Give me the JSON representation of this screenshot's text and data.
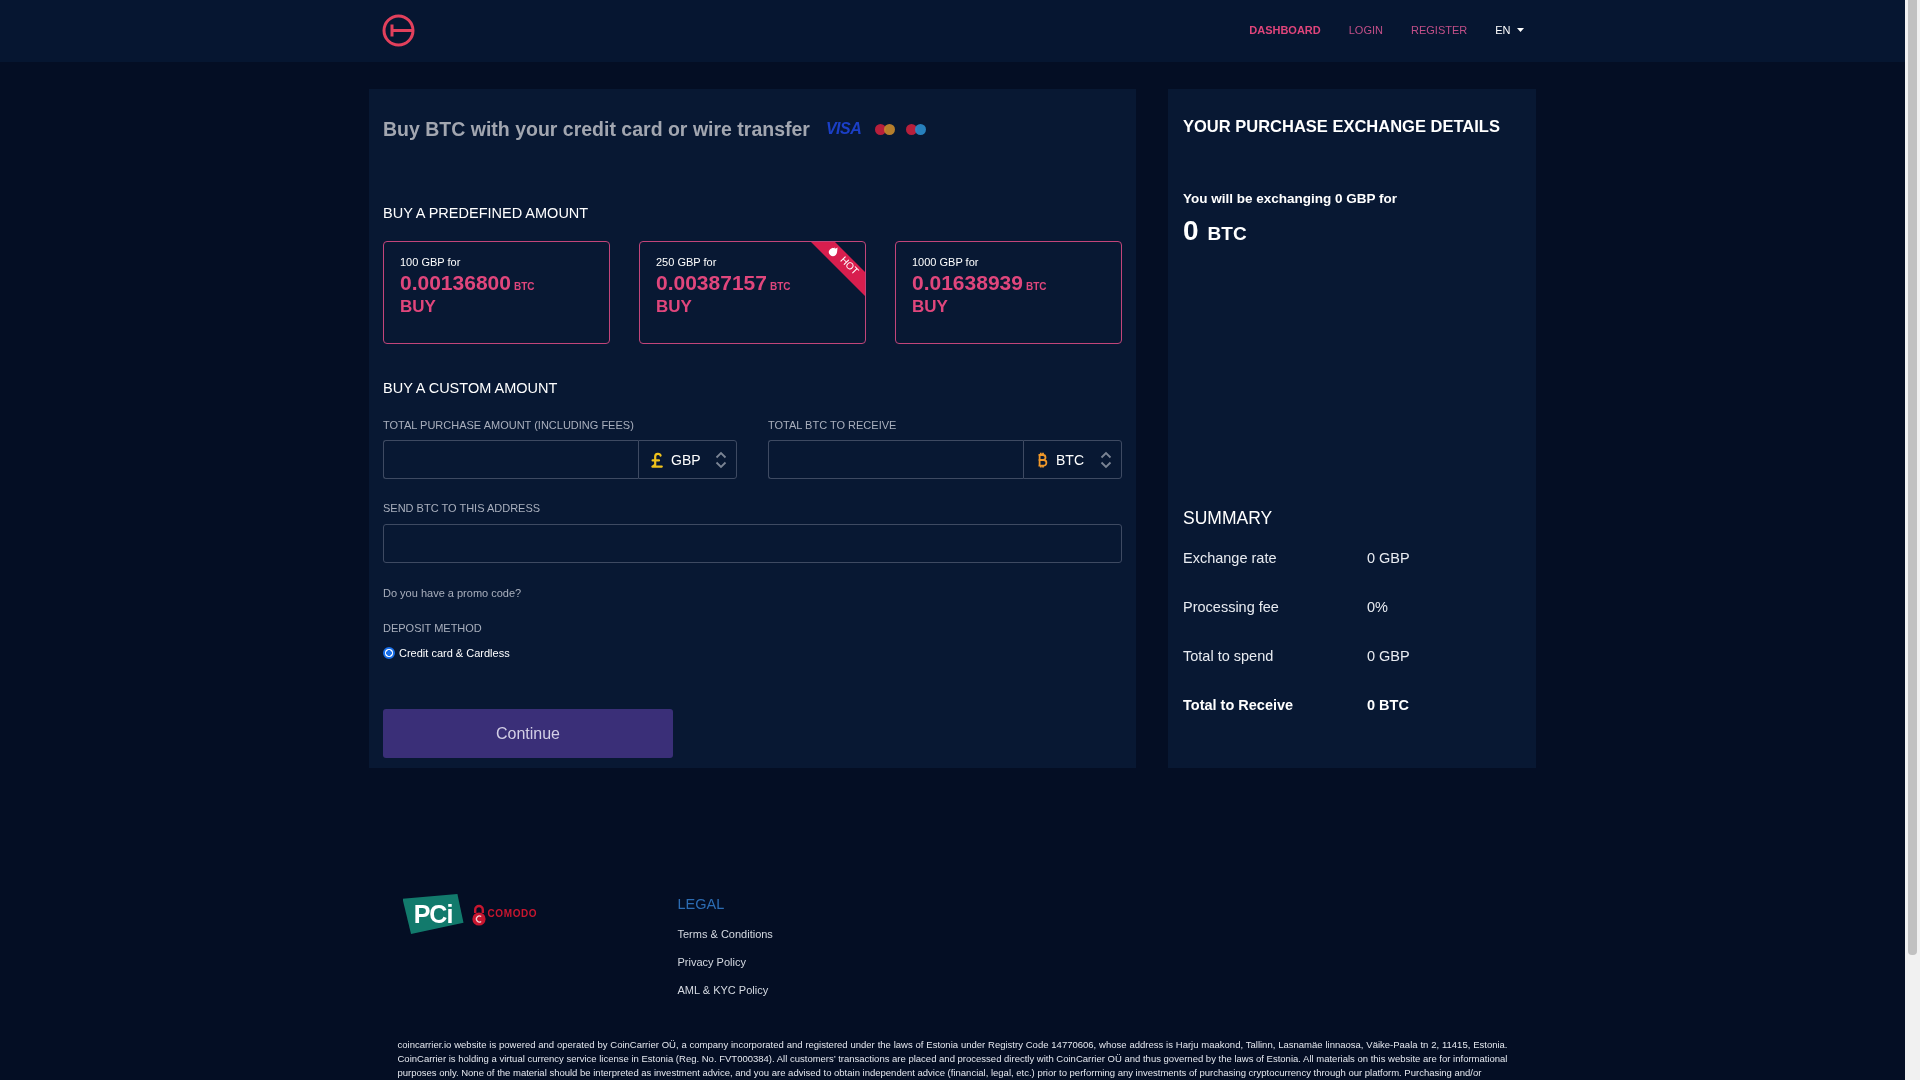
{
  "header": {
    "nav": [
      {
        "label": "DASHBOARD",
        "selected": true
      },
      {
        "label": "LOGIN",
        "selected": false
      },
      {
        "label": "REGISTER",
        "selected": false
      }
    ],
    "language": "EN"
  },
  "purchase_form": {
    "title": "Buy BTC with your credit card or wire transfer",
    "payment_methods": [
      {
        "kind": "wordmark",
        "text": "VISA"
      },
      {
        "kind": "mastercard"
      },
      {
        "kind": "maestro"
      }
    ],
    "predefined": {
      "heading": "BUY A PREDEFINED AMOUNT",
      "offers": [
        {
          "amount": "100 GBP for",
          "btc": "0.00136800",
          "unit": "BTC",
          "action": "BUY"
        },
        {
          "amount": "250 GBP for",
          "btc": "0.00387157",
          "unit": "BTC",
          "action": "BUY",
          "badge": "HOT"
        },
        {
          "amount": "1000 GBP for",
          "btc": "0.01638939",
          "unit": "BTC",
          "action": "BUY"
        }
      ]
    },
    "custom": {
      "heading": "BUY A CUSTOM AMOUNT",
      "fields": [
        {
          "kind": "pound",
          "label": "TOTAL PURCHASE AMOUNT (INCLUDING FEES)",
          "currency": "GBP"
        },
        {
          "kind": "bitcoin",
          "label": "TOTAL BTC TO RECEIVE",
          "currency": "BTC"
        }
      ],
      "address_label": "SEND BTC TO THIS ADDRESS"
    },
    "promo_link": "Do you have a promo code?",
    "deposit": {
      "label": "DEPOSIT METHOD",
      "options": [
        {
          "label": "Credit card & Cardless",
          "selected": true
        }
      ]
    },
    "submit": "Continue"
  },
  "details": {
    "title": "YOUR PURCHASE EXCHANGE DETAILS",
    "exchanging": "You will be exchanging 0 GBP for",
    "amount": "0",
    "unit": "BTC",
    "summary": {
      "heading": "SUMMARY",
      "rows": [
        {
          "kind": "line",
          "label": "Exchange rate",
          "value": "0 GBP"
        },
        {
          "kind": "line",
          "label": "Processing fee",
          "value": "0%"
        },
        {
          "kind": "line",
          "label": "Total to spend",
          "value": "0 GBP"
        },
        {
          "kind": "total",
          "label": "Total to Receive",
          "value": "0 BTC"
        }
      ]
    }
  },
  "footer": {
    "certifications": [
      {
        "kind": "badge",
        "text": "PCi"
      },
      {
        "kind": "lock",
        "text": "COMODO"
      }
    ],
    "legal": {
      "heading": "LEGAL",
      "links": [
        "Terms & Conditions",
        "Privacy Policy",
        "AML & KYC Policy"
      ]
    },
    "disclaimer": "coincarrier.io website is powered and operated by CoinCarrier OÜ, a company incorporated and registered under the laws of Estonia under Registry Code 14770606, whose address is Harju maakond, Tallinn, Lasnamäe linnaosa, Väike-Paala tn 2, 11415, Estonia. CoinCarrier is holding a virtual currency service license in Estonia (Reg. No. FVT000384). All customers’ transactions are placed and processed directly with CoinCarrier OÜ and thus governed by the laws of Estonia. All materials on this website are for informational purposes only. None of the material should be interpreted as investment advice, and you are advised to obtain independent advice (financial, legal, etc.) prior to performing any investments of purchasing cryptocurrency through our platform. Purchasing and/or"
  }
}
